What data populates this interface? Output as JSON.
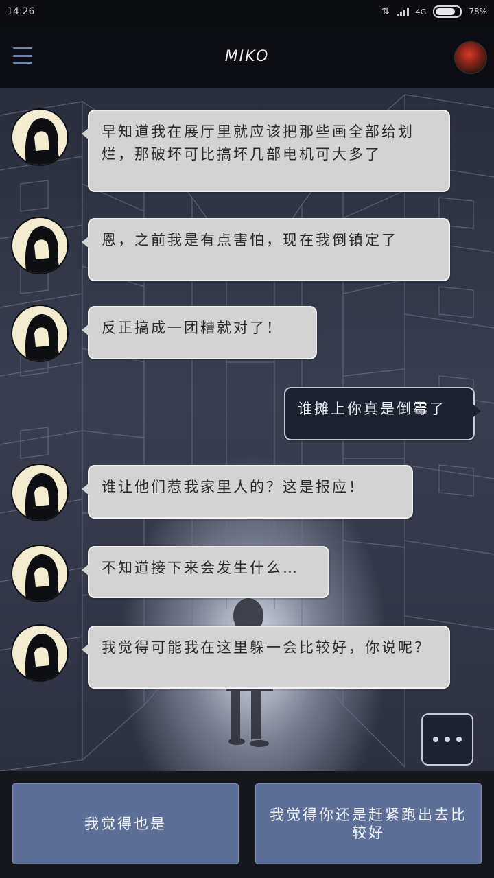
{
  "status_bar": {
    "time": "14:26",
    "network": "4G",
    "battery": "78%"
  },
  "header": {
    "title": "MIKO"
  },
  "messages": [
    {
      "sender": "miko",
      "text": "早知道我在展厅里就应该把那些画全部给划烂，那破坏可比搞坏几部电机可大多了"
    },
    {
      "sender": "miko",
      "text": "恩，之前我是有点害怕，现在我倒镇定了"
    },
    {
      "sender": "miko",
      "text": "反正搞成一团糟就对了！"
    },
    {
      "sender": "me",
      "text": "谁摊上你真是倒霉了"
    },
    {
      "sender": "miko",
      "text": "谁让他们惹我家里人的？这是报应！"
    },
    {
      "sender": "miko",
      "text": "不知道接下来会发生什么…"
    },
    {
      "sender": "miko",
      "text": "我觉得可能我在这里躲一会比较好，你说呢？"
    }
  ],
  "replies": [
    {
      "label": "我觉得也是"
    },
    {
      "label": "我觉得你还是赶紧跑出去比较好"
    }
  ],
  "colors": {
    "reply_button": "#5d6f98",
    "bubble_other": "#d3d3d3",
    "bubble_mine": "#1c2230",
    "menu_icon": "#6f85b4"
  }
}
